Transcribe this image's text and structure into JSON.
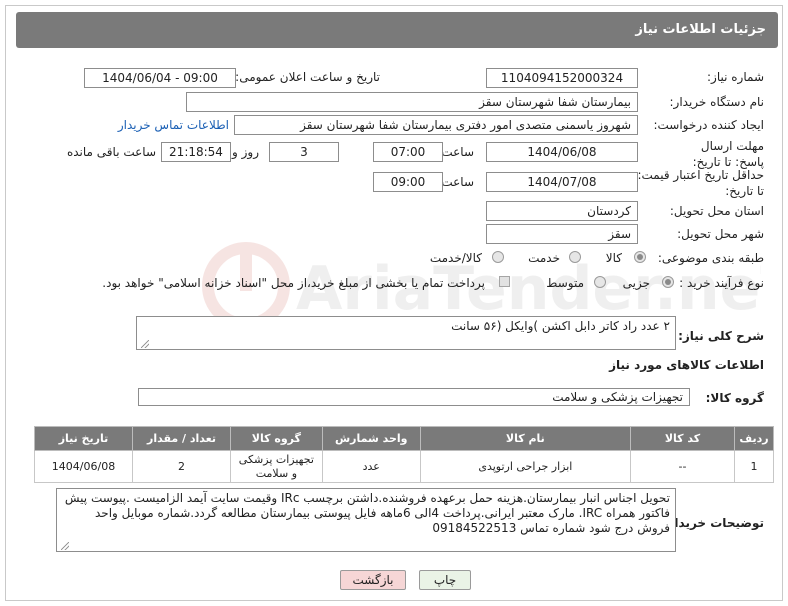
{
  "page_title": "جزئیات اطلاعات نیاز",
  "fields": {
    "need_number": {
      "label": "شماره نیاز:",
      "value": "1104094152000324"
    },
    "announce_datetime": {
      "label": "تاریخ و ساعت اعلان عمومی:",
      "value": "1404/06/04 - 09:00"
    },
    "buyer_org": {
      "label": "نام دستگاه خریدار:",
      "value": "بیمارستان شفا شهرستان سقز"
    },
    "requester": {
      "label": "ایجاد کننده درخواست:",
      "value": "شهروز یاسمنی متصدی امور دفتری بیمارستان شفا شهرستان سقز",
      "contact_link": "اطلاعات تماس خریدار"
    },
    "reply_deadline": {
      "label": "مهلت ارسال پاسخ: تا تاریخ:",
      "date": "1404/06/08",
      "time_label": "ساعت",
      "time": "07:00",
      "days": "3",
      "days_label": "روز و",
      "remaining": "21:18:54",
      "remaining_label": "ساعت باقی مانده"
    },
    "price_validity": {
      "label": "حداقل تاریخ اعتبار قیمت: تا تاریخ:",
      "date": "1404/07/08",
      "time_label": "ساعت",
      "time": "09:00"
    },
    "delivery_province": {
      "label": "استان محل تحویل:",
      "value": "کردستان"
    },
    "delivery_city": {
      "label": "شهر محل تحویل:",
      "value": "سقز"
    },
    "category": {
      "label": "طبقه بندی موضوعی:",
      "options": [
        "کالا",
        "خدمت",
        "کالا/خدمت"
      ]
    },
    "process_type": {
      "label": "نوع فرآیند خرید :",
      "options": [
        "جزیی",
        "متوسط"
      ],
      "payment_note": "پرداخت تمام یا بخشی از مبلغ خرید،از محل \"اسناد خزانه اسلامی\" خواهد بود."
    }
  },
  "general_description": {
    "label": "شرح کلی نیاز:",
    "value": "۲ عدد راد کاتر دابل اکشن )وایکل (۵۶ سانت"
  },
  "goods_section_title": "اطلاعات کالاهای مورد نیاز",
  "goods_group": {
    "label": "گروه کالا:",
    "value": "تجهیزات پزشکی و سلامت"
  },
  "table": {
    "headers": [
      "ردیف",
      "کد کالا",
      "نام کالا",
      "واحد شمارش",
      "گروه کالا",
      "تعداد / مقدار",
      "تاریخ نیاز"
    ],
    "rows": [
      [
        "1",
        "--",
        "ابزار جراحی ارتوپدی",
        "عدد",
        "تجهیزات پزشکی و سلامت",
        "2",
        "1404/06/08"
      ]
    ]
  },
  "buyer_notes": {
    "label": "توضیحات خریدار:",
    "value": "تحویل اجناس انبار بیمارستان.هزینه حمل برعهده فروشنده.داشتن برچسب IRc وقیمت سایت آیمد الزامیست .پیوست پیش فاکتور همراه IRC. مارک معتبر ایرانی.پرداخت 4الی 6ماهه فایل پیوستی بیمارستان مطالعه گردد.شماره موبایل واحد فروش درج شود شماره تماس 09184522513"
  },
  "buttons": {
    "print": "چاپ",
    "back": "بازگشت"
  },
  "watermark": {
    "text": "AriaTender.neT"
  },
  "colors": {
    "header_bg": "#7a7a7a",
    "link": "#1a5fb4",
    "back_button_bg": "#f6d6d6",
    "print_button_bg": "#eaf3e6"
  }
}
